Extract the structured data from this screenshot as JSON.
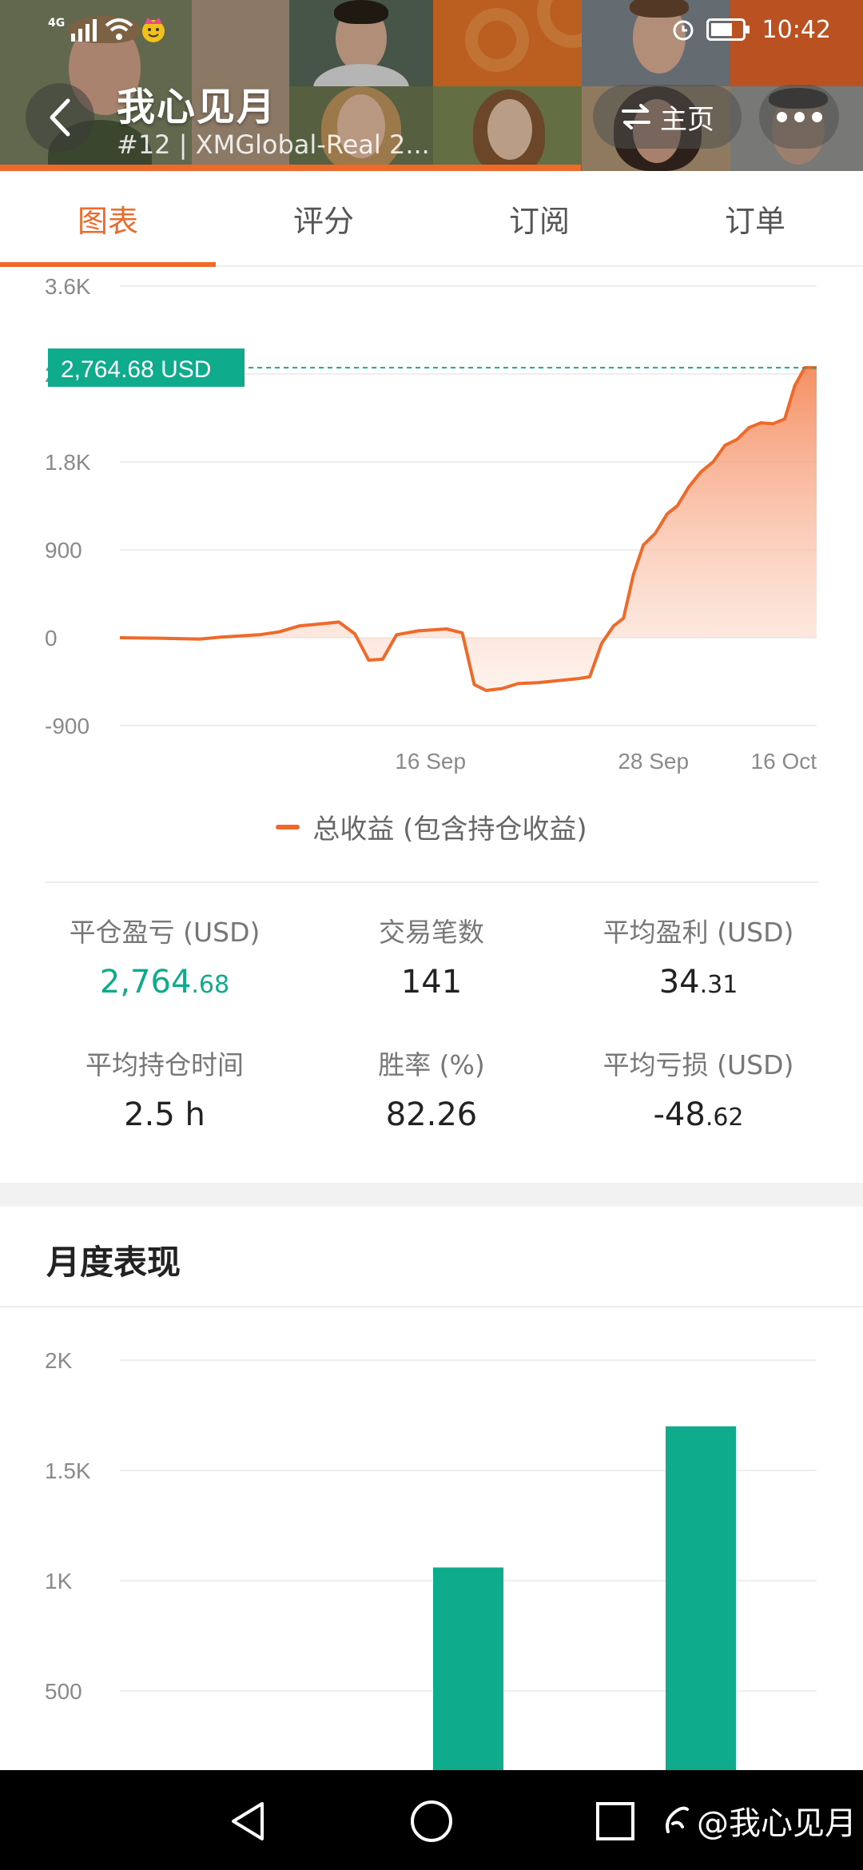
{
  "status_bar": {
    "network": "4G",
    "time": "10:42"
  },
  "header": {
    "title": "我心见月",
    "subtitle": "#12 | XMGlobal-Real 2...",
    "home_label": "主页"
  },
  "tabs": [
    {
      "label": "图表",
      "active": true
    },
    {
      "label": "评分",
      "active": false
    },
    {
      "label": "订阅",
      "active": false
    },
    {
      "label": "订单",
      "active": false
    }
  ],
  "colors": {
    "accent": "#ee6a2a",
    "green": "#0fab8d",
    "fill": "#fbd3c1"
  },
  "chart_data": [
    {
      "type": "area",
      "title": "",
      "y_ticks": [
        "3.6K",
        "2,7K",
        "1.8K",
        "900",
        "0",
        "-900"
      ],
      "x_ticks": [
        "16 Sep",
        "28 Sep",
        "16 Oct"
      ],
      "ylim": [
        -900,
        3600
      ],
      "grid": true,
      "series": [
        {
          "name": "总收益 (包含持仓收益)",
          "points": [
            [
              0,
              0
            ],
            [
              2,
              -5
            ],
            [
              4,
              -15
            ],
            [
              5,
              5
            ],
            [
              7,
              30
            ],
            [
              8,
              60
            ],
            [
              9,
              120
            ],
            [
              10,
              140
            ],
            [
              11,
              160
            ],
            [
              11.8,
              40
            ],
            [
              12.5,
              -230
            ],
            [
              13.2,
              -220
            ],
            [
              13.9,
              30
            ],
            [
              15,
              70
            ],
            [
              16.4,
              90
            ],
            [
              17.2,
              50
            ],
            [
              17.8,
              -480
            ],
            [
              18.4,
              -540
            ],
            [
              19.2,
              -520
            ],
            [
              20,
              -470
            ],
            [
              21,
              -460
            ],
            [
              22,
              -440
            ],
            [
              23,
              -420
            ],
            [
              23.6,
              -400
            ],
            [
              24.2,
              -60
            ],
            [
              24.8,
              120
            ],
            [
              25.3,
              200
            ],
            [
              25.8,
              650
            ],
            [
              26.3,
              950
            ],
            [
              26.9,
              1070
            ],
            [
              27.5,
              1270
            ],
            [
              28,
              1350
            ],
            [
              28.6,
              1550
            ],
            [
              29.2,
              1700
            ],
            [
              29.8,
              1800
            ],
            [
              30.4,
              1970
            ],
            [
              31,
              2030
            ],
            [
              31.6,
              2150
            ],
            [
              32.2,
              2200
            ],
            [
              32.8,
              2190
            ],
            [
              33.4,
              2240
            ],
            [
              33.9,
              2580
            ],
            [
              34.4,
              2764.68
            ],
            [
              35,
              2764.68
            ]
          ]
        }
      ],
      "current_value_label": "2,764.68 USD",
      "current_value": 2764.68
    },
    {
      "type": "bar",
      "title": "月度表现",
      "y_ticks": [
        "2K",
        "1.5K",
        "1K",
        "500"
      ],
      "ylim": [
        0,
        2000
      ],
      "grid": true,
      "series": [
        {
          "name": "",
          "values": [
            1060,
            1700
          ]
        }
      ]
    }
  ],
  "legend": {
    "label": "总收益 (包含持仓收益)"
  },
  "stats": [
    {
      "label": "平仓盈亏 (USD)",
      "int": "2,764",
      "dec": ".68",
      "green": true
    },
    {
      "label": "交易笔数",
      "int": "141",
      "dec": "",
      "green": false
    },
    {
      "label": "平均盈利 (USD)",
      "int": "34",
      "dec": ".31",
      "green": false
    },
    {
      "label": "平均持仓时间",
      "int": "2.5 h",
      "dec": "",
      "green": false
    },
    {
      "label": "胜率 (%)",
      "int": "82.26",
      "dec": "",
      "green": false
    },
    {
      "label": "平均亏损 (USD)",
      "int": "-48",
      "dec": ".62",
      "green": false
    }
  ],
  "section": {
    "title": "月度表现"
  },
  "watermark": "@我心见月"
}
